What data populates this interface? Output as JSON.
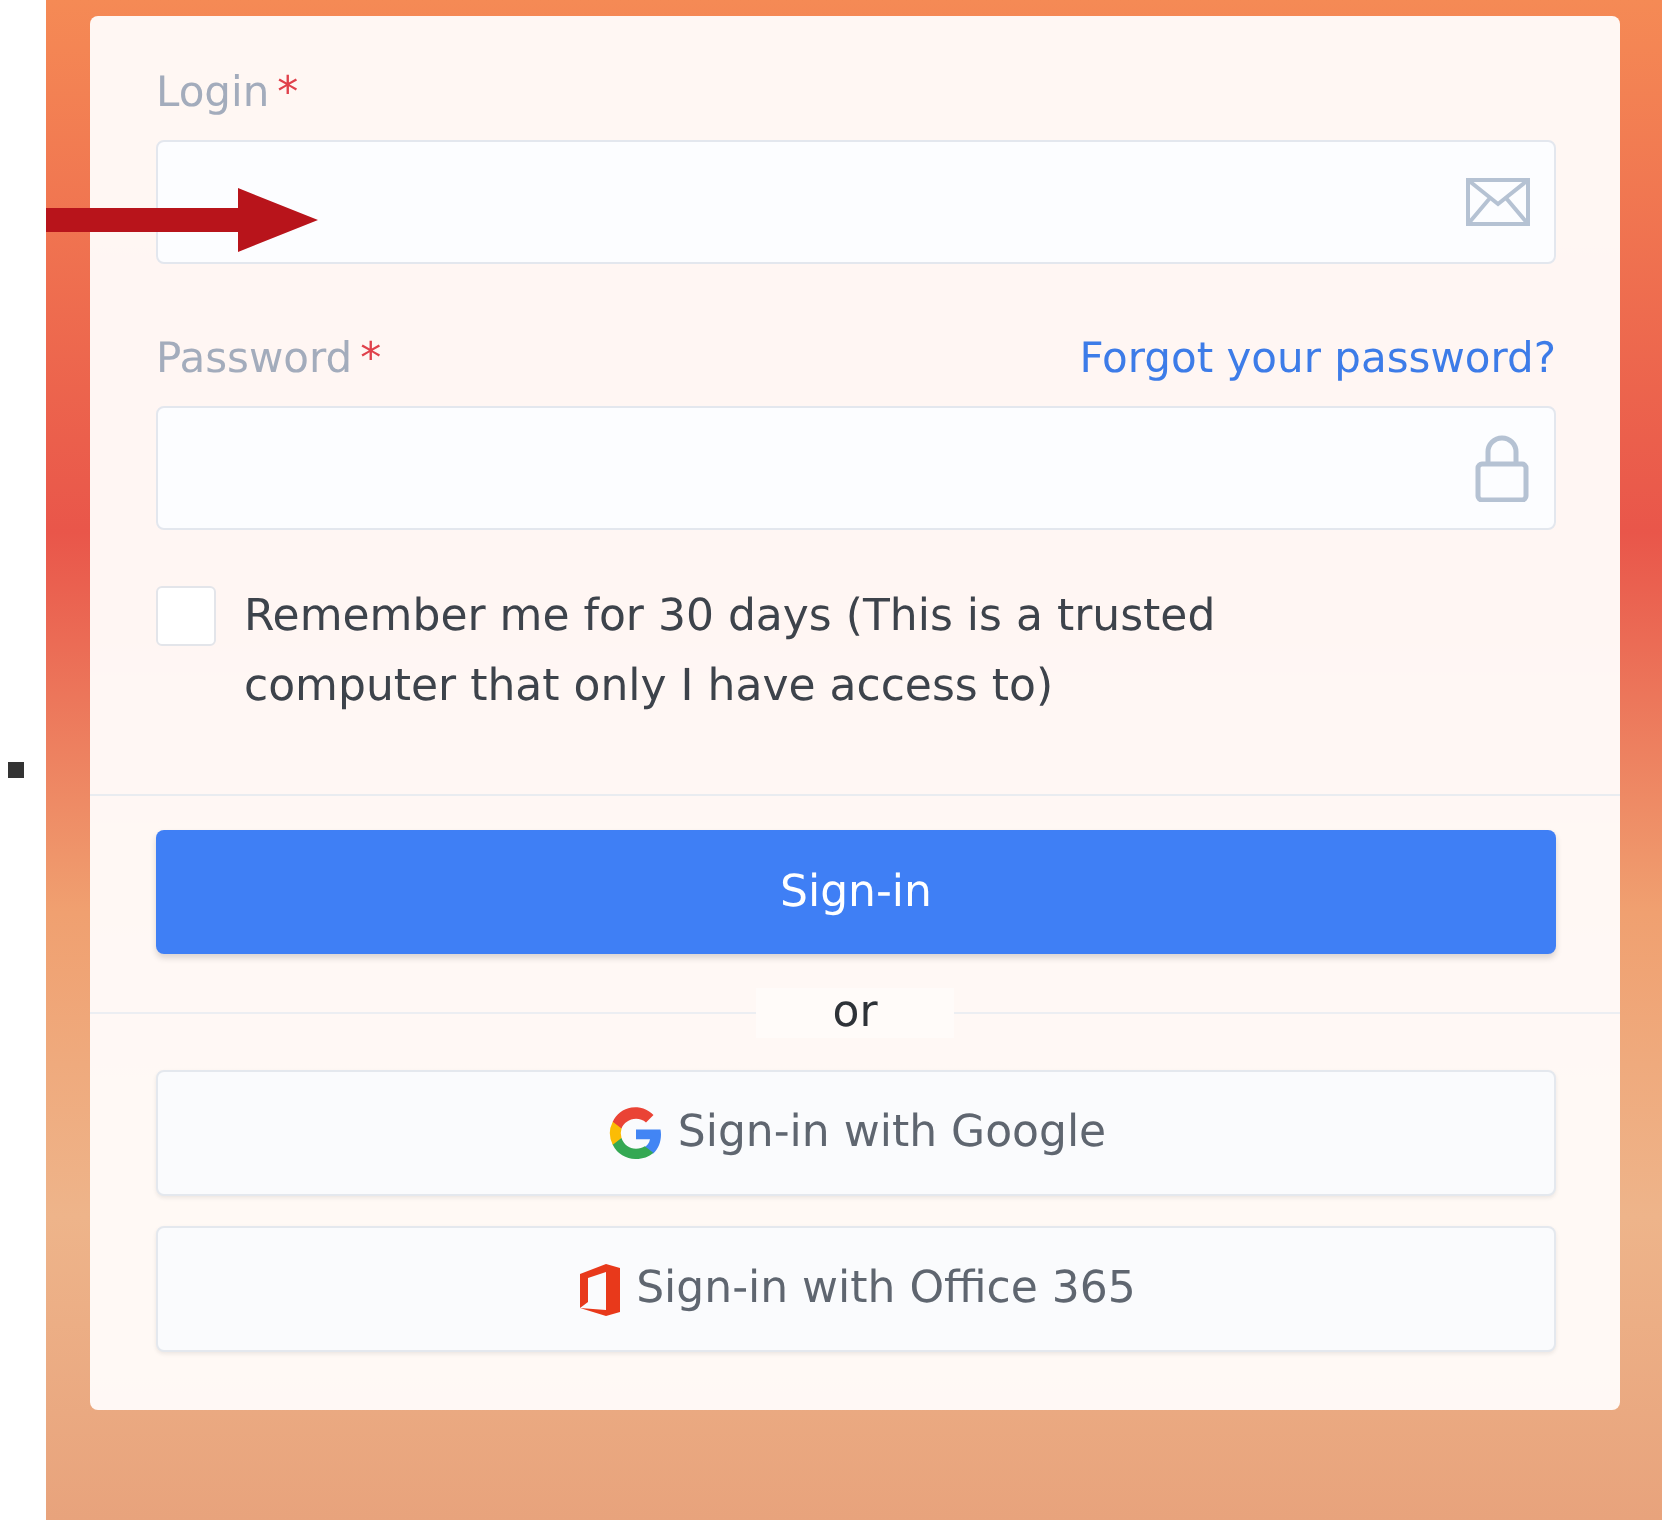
{
  "login": {
    "label": "Login",
    "required": true,
    "required_mark": "*"
  },
  "password": {
    "label": "Password",
    "required": true,
    "required_mark": "*",
    "forgot_link": "Forgot your password?"
  },
  "remember": {
    "label": "Remember me for 30 days (This is a trusted computer that only I have access to)",
    "checked": false
  },
  "sign_in": "Sign-in",
  "divider": "or",
  "providers": [
    {
      "kind": "google",
      "label": "Sign-in with Google"
    },
    {
      "kind": "office",
      "label": "Sign-in with Office 365"
    }
  ]
}
